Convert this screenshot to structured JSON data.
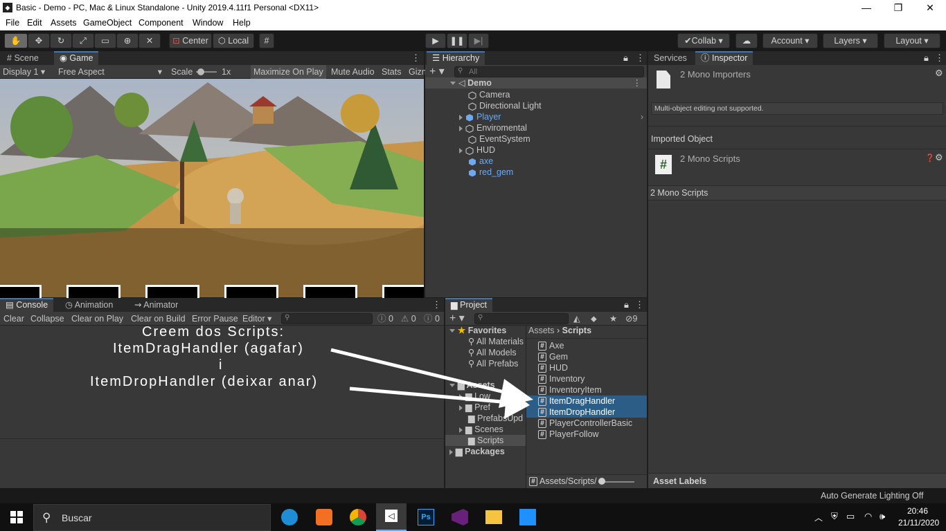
{
  "window": {
    "title": "Basic - Demo - PC, Mac & Linux Standalone - Unity 2019.4.11f1 Personal <DX11>",
    "minimize": "—",
    "maximize": "❐",
    "close": "✕"
  },
  "menu": [
    "File",
    "Edit",
    "Assets",
    "GameObject",
    "Component",
    "Window",
    "Help"
  ],
  "toolbar": {
    "center": "Center",
    "local": "Local",
    "collab": "Collab",
    "account": "Account",
    "layers": "Layers",
    "layout": "Layout"
  },
  "game_panel": {
    "tabs": [
      "Scene",
      "Game"
    ],
    "display": "Display 1",
    "aspect": "Free Aspect",
    "scale_label": "Scale",
    "scale_value": "1x",
    "maximize": "Maximize On Play",
    "mute": "Mute Audio",
    "stats": "Stats",
    "gizmos": "Gizn"
  },
  "hierarchy": {
    "tab": "Hierarchy",
    "search_placeholder": "All",
    "root": "Demo",
    "items": [
      "Camera",
      "Directional Light",
      "Player",
      "Enviromental",
      "EventSystem",
      "HUD",
      "axe",
      "red_gem"
    ]
  },
  "inspector": {
    "tabs": [
      "Services",
      "Inspector"
    ],
    "header": "2 Mono Importers",
    "note": "Multi-object editing not supported.",
    "imported_object": "Imported Object",
    "scripts_header": "2 Mono Scripts",
    "scripts_bar": "2 Mono Scripts",
    "asset_labels": "Asset Labels"
  },
  "console": {
    "tabs": [
      "Console",
      "Animation",
      "Animator"
    ],
    "buttons": [
      "Clear",
      "Collapse",
      "Clear on Play",
      "Clear on Build",
      "Error Pause",
      "Editor"
    ],
    "counts": [
      "0",
      "0",
      "0"
    ],
    "annotation": [
      "Creem dos Scripts:",
      "ItemDragHandler (agafar)",
      "i",
      "ItemDropHandler (deixar anar)"
    ]
  },
  "project": {
    "tab": "Project",
    "hidden_count": "9",
    "tree": [
      "Favorites",
      "All Materials",
      "All Models",
      "All Prefabs",
      "Assets",
      "Low",
      "Pref",
      "PrefabsUpd",
      "Scenes",
      "Scripts",
      "Packages"
    ],
    "breadcrumb": [
      "Assets",
      "Scripts"
    ],
    "files": [
      "Axe",
      "Gem",
      "HUD",
      "Inventory",
      "InventoryItem",
      "ItemDragHandler",
      "ItemDropHandler",
      "PlayerControllerBasic",
      "PlayerFollow"
    ],
    "footer_path": "Assets/Scripts/"
  },
  "status": {
    "lighting": "Auto Generate Lighting Off"
  },
  "taskbar": {
    "search": "Buscar",
    "time": "20:46",
    "date": "21/11/2020"
  }
}
